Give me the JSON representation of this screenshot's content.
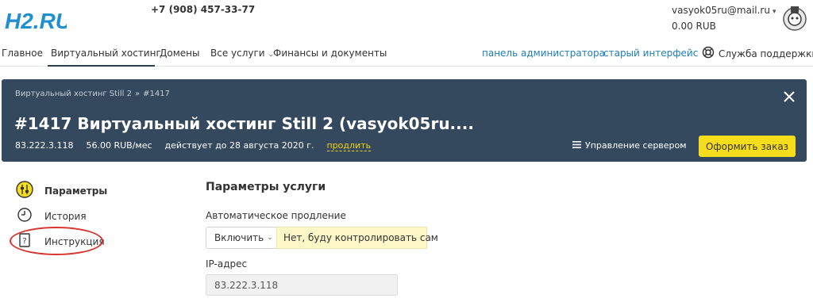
{
  "header": {
    "logo_text": "H2.RU",
    "phone": "+7 (908) 457-33-77",
    "email": "vasyok05ru@mail.ru",
    "balance": "0.00 RUB"
  },
  "nav": {
    "items": [
      "Главное",
      "Виртуальный хостинг",
      "Домены",
      "Все услуги",
      "Финансы и документы"
    ],
    "admin_panel": "панель администратора",
    "old_interface": "старый интерфейс",
    "support": "Служба поддержки"
  },
  "panel": {
    "breadcrumb": [
      "Виртуальный хостинг Still 2",
      "#1417"
    ],
    "breadcrumb_sep": "»",
    "title": "#1417 Виртуальный хостинг Still 2 (vasyok05ru....",
    "ip": "83.222.3.118",
    "price": "56.00 RUB/мес",
    "valid_until": "действует до 28 августа 2020 г.",
    "renew": "продлить",
    "manage": "Управление сервером",
    "order": "Оформить заказ"
  },
  "sidebar": {
    "items": [
      "Параметры",
      "История",
      "Инструкция"
    ]
  },
  "content": {
    "section_title": "Параметры услуги",
    "auto_renew_label": "Автоматическое продление",
    "auto_renew_value": "Включить",
    "auto_renew_hint": "Нет, буду контролировать сам",
    "ip_label": "IP-адрес",
    "ip_value": "83.222.3.118"
  },
  "colors": {
    "panel_bg": "#34495e",
    "accent_yellow": "#f6dd1c",
    "link_blue": "#1d7fb8",
    "annotation_red": "#d6342c"
  }
}
